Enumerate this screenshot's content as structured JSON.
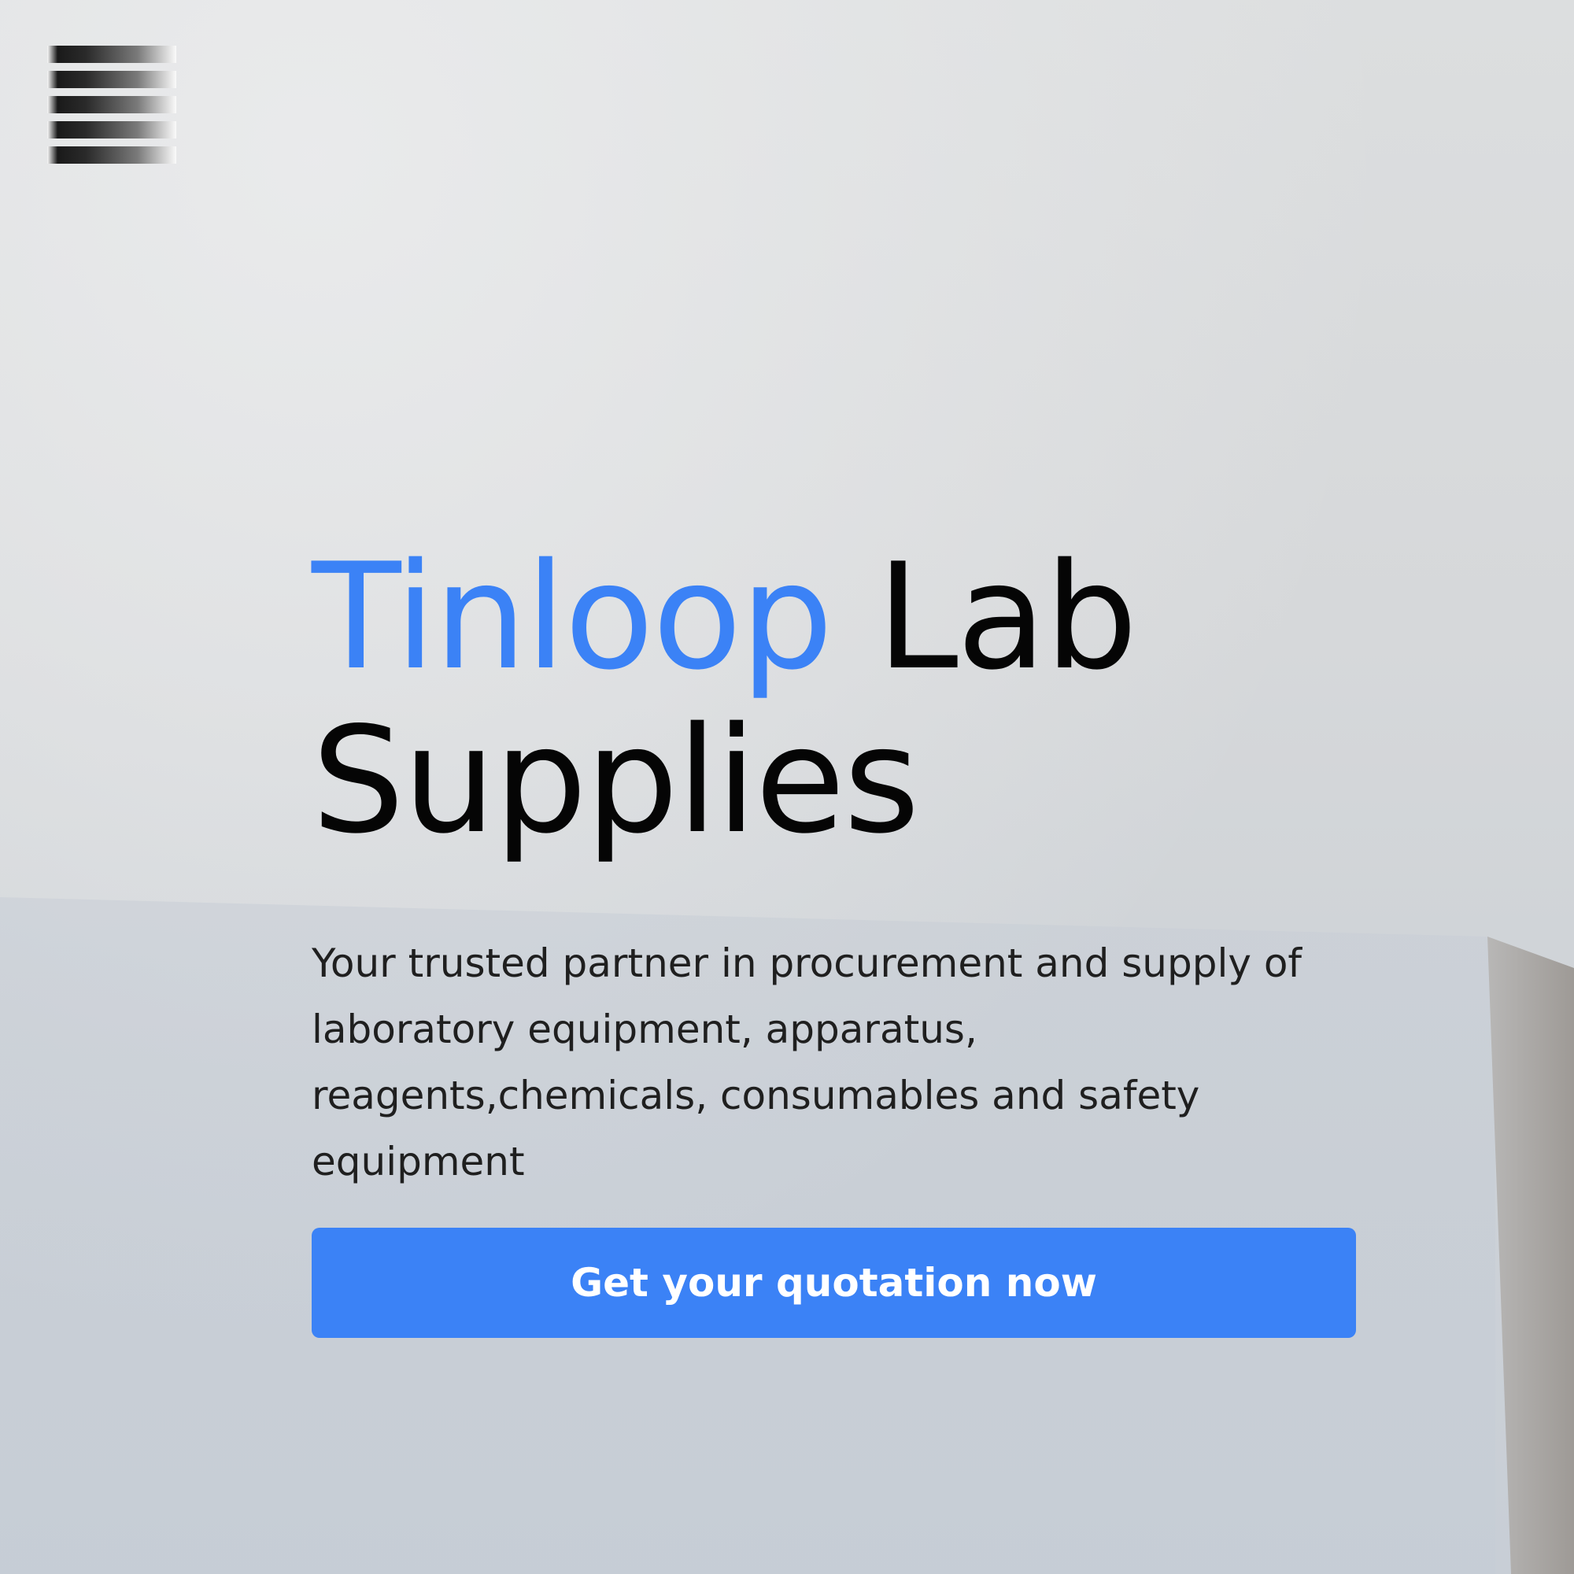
{
  "header": {
    "menu_icon": "hamburger-menu-icon"
  },
  "hero": {
    "title_brand": "Tinloop",
    "title_rest": "Lab Supplies",
    "subtitle": "Your trusted partner in procurement and supply of laboratory equipment, apparatus, reagents,chemicals, consumables and safety equipment",
    "cta_label": "Get your quotation now"
  },
  "colors": {
    "accent": "#3b82f6",
    "heading": "#050505",
    "body_text": "#1f1f1f",
    "background": "#d3d6d9"
  }
}
